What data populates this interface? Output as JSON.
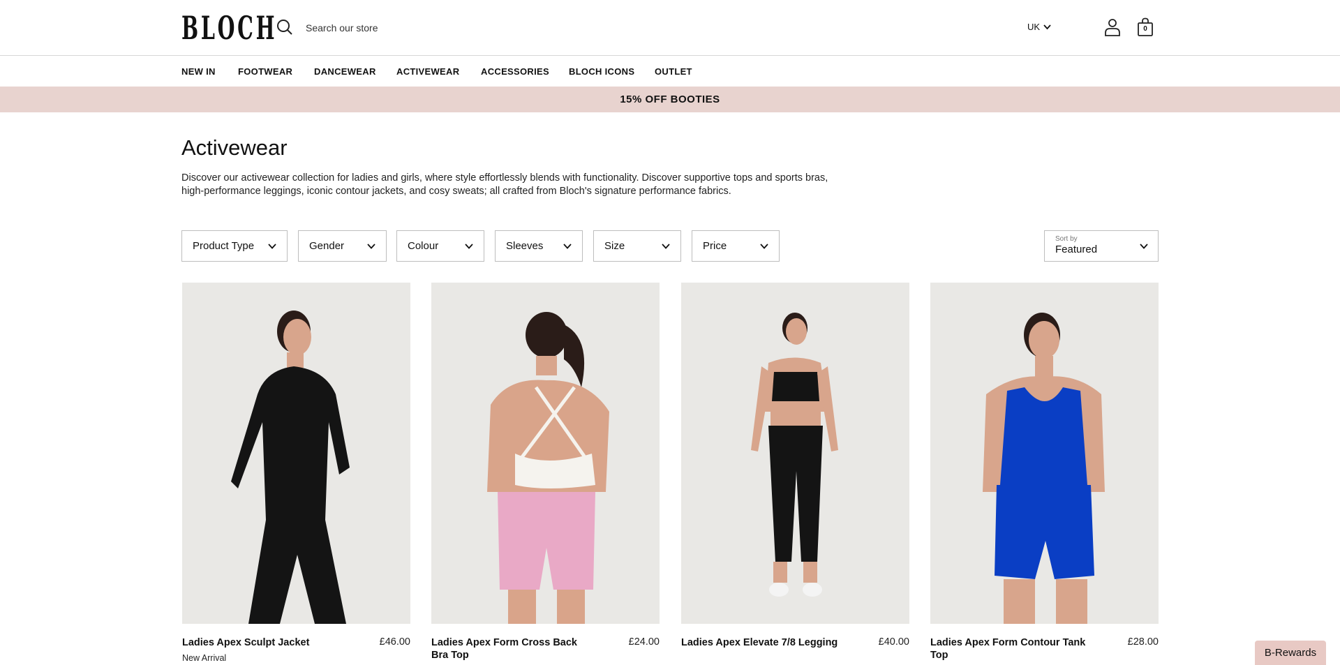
{
  "header": {
    "logo_text": "BLOCH",
    "search_placeholder": "Search our store",
    "region": "UK",
    "bag_count": "0"
  },
  "nav": {
    "items": [
      "NEW IN",
      "FOOTWEAR",
      "DANCEWEAR",
      "ACTIVEWEAR",
      "ACCESSORIES",
      "BLOCH ICONS",
      "OUTLET"
    ]
  },
  "promo": {
    "text": "15% OFF BOOTIES"
  },
  "page": {
    "title": "Activewear",
    "description": "Discover our activewear collection for ladies and girls, where style effortlessly blends with functionality. Discover supportive tops and sports bras, high-performance leggings, iconic contour jackets, and cosy sweats; all crafted from Bloch's signature performance fabrics."
  },
  "filters": [
    "Product Type",
    "Gender",
    "Colour",
    "Sleeves",
    "Size",
    "Price"
  ],
  "sort": {
    "label": "Sort by",
    "value": "Featured"
  },
  "products": [
    {
      "name": "Ladies Apex Sculpt Jacket",
      "price": "£46.00",
      "badge": "New Arrival",
      "garment_color": "#141414"
    },
    {
      "name": "Ladies Apex Form Cross Back Bra Top",
      "price": "£24.00",
      "badge": "",
      "garment_color": "#e9a9c6"
    },
    {
      "name": "Ladies Apex Elevate 7/8 Legging",
      "price": "£40.00",
      "badge": "",
      "garment_color": "#141414"
    },
    {
      "name": "Ladies Apex Form Contour Tank Top",
      "price": "£28.00",
      "badge": "",
      "garment_color": "#0a3ec4"
    }
  ],
  "rewards": {
    "label": "B-Rewards"
  },
  "colors": {
    "promo_bg": "#e8d3cf",
    "image_bg": "#e9e8e5",
    "rewards_bg": "#e8c9c4"
  }
}
